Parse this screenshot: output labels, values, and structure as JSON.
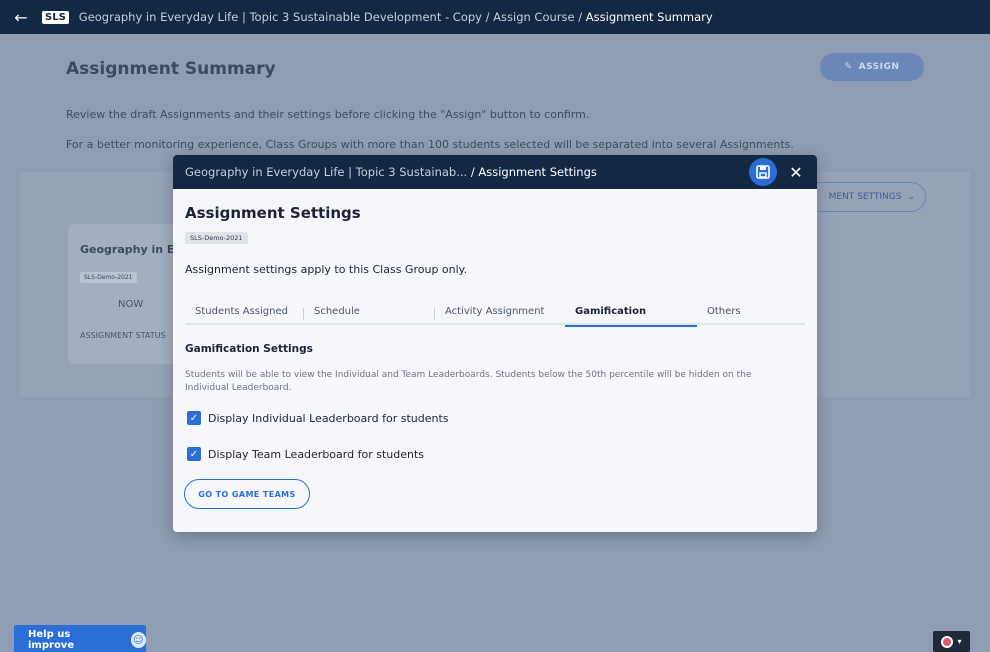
{
  "topbar": {
    "logo": "SLS",
    "breadcrumb": "Geography in Everyday Life | Topic 3 Sustainable Development - Copy / Assign Course / ",
    "current": "Assignment Summary"
  },
  "page": {
    "title": "Assignment Summary",
    "assign_label": "ASSIGN",
    "line1": "Review the draft Assignments and their settings before clicking the \"Assign\" button to confirm.",
    "line2": "For a better monitoring experience, Class Groups with more than 100 students selected will be separated into several Assignments.",
    "card_title": "Geography in Ev",
    "card_chip": "SLS-Demo-2021",
    "card_now": "NOW",
    "card_status": "ASSIGNMENT STATUS",
    "settings_pill": "MENT SETTINGS"
  },
  "modal": {
    "breadcrumb": "Geography in Everyday Life | Topic 3 Sustainab... ",
    "current": "/ Assignment Settings",
    "title": "Assignment Settings",
    "class_chip": "SLS-Demo-2021",
    "description": "Assignment settings apply to this Class Group only.",
    "tabs": [
      "Students Assigned",
      "Schedule",
      "Activity Assignment",
      "Gamification",
      "Others"
    ],
    "section_title": "Gamification Settings",
    "section_desc": "Students will be able to view the Individual and Team Leaderboards. Students below the 50th percentile will be hidden on the Individual Leaderboard.",
    "option1": "Display Individual Leaderboard for students",
    "option2": "Display Team Leaderboard for students",
    "game_teams_label": "GO TO GAME TEAMS"
  },
  "footer": {
    "help_label": "Help us improve",
    "lang_caret": "▾"
  },
  "colors": {
    "accent": "#2b6fd6",
    "header": "#132843"
  }
}
